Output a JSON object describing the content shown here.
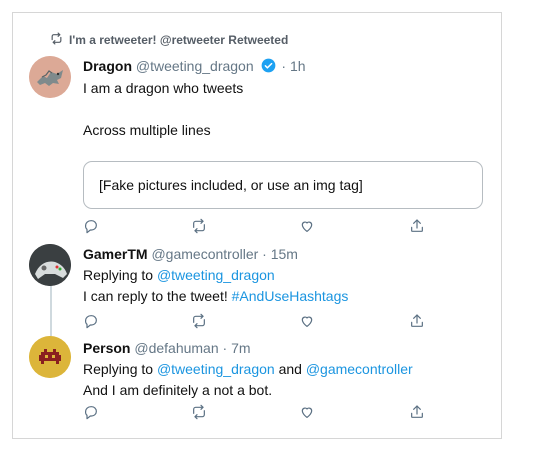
{
  "retweet_banner": {
    "text": "I'm a retweeter! @retweeter Retweeted"
  },
  "tweets": [
    {
      "author_name": "Dragon",
      "author_handle": "@tweeting_dragon",
      "time": "· 1h",
      "verified": true,
      "line1": "I am a dragon who tweets",
      "line2": "Across multiple lines",
      "media_text": "[Fake pictures included, or use an img tag]"
    },
    {
      "author_name": "GamerTM",
      "author_handle": "@gamecontroller",
      "time": "· 15m",
      "replying_prefix": "Replying to",
      "replying_to": "@tweeting_dragon",
      "text": "I can reply to the tweet!",
      "hashtag": "#AndUseHashtags"
    },
    {
      "author_name": "Person",
      "author_handle": "@defahuman",
      "time": "· 7m",
      "replying_prefix": "Replying to",
      "replying_to_1": "@tweeting_dragon",
      "replying_and": "and",
      "replying_to_2": "@gamecontroller",
      "text": "And I am definitely a not a bot."
    }
  ],
  "icons": {
    "retweet": "retweet-icon",
    "reply": "reply-icon",
    "like": "like-icon",
    "share": "share-icon",
    "verified": "verified-badge-icon"
  },
  "colors": {
    "link": "#1b95e0",
    "muted": "#657786",
    "verified": "#1da1f2"
  }
}
